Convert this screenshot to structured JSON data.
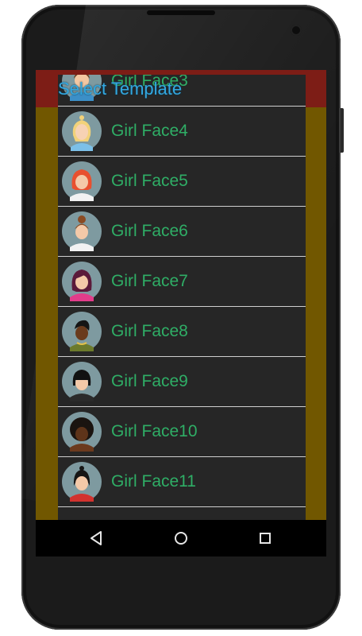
{
  "dialog": {
    "title": "Select Template",
    "items": [
      {
        "label": "Girl Face3",
        "icon": "girl-face-3-icon"
      },
      {
        "label": "Girl Face4",
        "icon": "girl-face-4-icon"
      },
      {
        "label": "Girl Face5",
        "icon": "girl-face-5-icon"
      },
      {
        "label": "Girl Face6",
        "icon": "girl-face-6-icon"
      },
      {
        "label": "Girl Face7",
        "icon": "girl-face-7-icon"
      },
      {
        "label": "Girl Face8",
        "icon": "girl-face-8-icon"
      },
      {
        "label": "Girl Face9",
        "icon": "girl-face-9-icon"
      },
      {
        "label": "Girl Face10",
        "icon": "girl-face-10-icon"
      },
      {
        "label": "Girl Face11",
        "icon": "girl-face-11-icon"
      }
    ]
  },
  "navbar": {
    "back": "back-icon",
    "home": "home-icon",
    "recents": "recents-icon"
  },
  "colors": {
    "label_green": "#2fae66",
    "title_blue": "#33a8e0",
    "dialog_bg": "#262626",
    "app_bar_red": "#7d1d16",
    "app_bg_olive": "#715700"
  }
}
